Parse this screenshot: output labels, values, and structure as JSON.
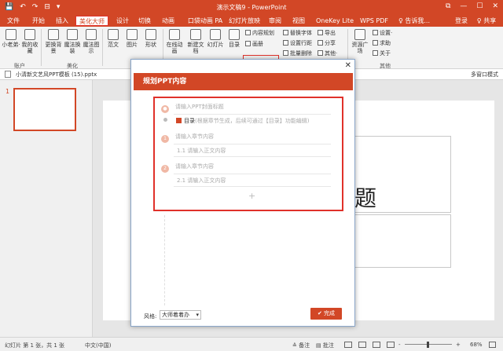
{
  "app": {
    "title": "演示文稿9 - PowerPoint"
  },
  "quick_access": {
    "save": "💾",
    "undo": "↶",
    "redo": "↷",
    "present": "⊟",
    "more": "▾"
  },
  "window_controls": {
    "restore": "⧉",
    "minimize": "—",
    "maximize": "☐",
    "close": "✕"
  },
  "tabs": [
    "文件",
    "开始",
    "插入",
    "美化大师",
    "设计",
    "切换",
    "动画",
    "口袋动画 PA",
    "幻灯片放映",
    "审阅",
    "视图",
    "OneKey Lite",
    "WPS PDF"
  ],
  "active_tab": "美化大师",
  "tell_me": "♀ 告诉我...",
  "login": "登录",
  "share": "♀ 共享",
  "ribbon": {
    "btn_xiaolaodi": "小老弟·",
    "btn_favorites": "我的收藏",
    "btn_replace_bg": "更换背景",
    "btn_magic_replace": "魔法换装",
    "btn_magic_illustrate": "魔法图示",
    "btn_template": "范文",
    "btn_image": "图片",
    "btn_shape": "形状",
    "btn_online_anim": "在线动画",
    "btn_new_doc": "新建文档",
    "btn_slides": "幻灯片",
    "btn_toc": "目录",
    "content_plan": "内容规划",
    "album": "画册",
    "replace_font": "替换字体",
    "set_line_spacing": "设置行距",
    "batch_delete": "批量删除",
    "export": "导出",
    "share_item": "分享",
    "other": "其他·",
    "resources": "资源广场",
    "settings": "设置·",
    "help": "求助",
    "about": "关于",
    "group_account": "账户",
    "group_beautify": "美化",
    "group_other": "其他"
  },
  "document_tab": {
    "name": "小清新文艺风PPT模板 (15).pptx",
    "multi_window": "多窗口模式"
  },
  "slides_panel": {
    "number": "1"
  },
  "slide": {
    "title_fragment": "标题"
  },
  "dialog": {
    "title": "规划PPT内容",
    "close": "✕",
    "cover_placeholder": "请输入PPT封面标题",
    "toc_label": "目录",
    "toc_hint": "(根据章节生成，后续可通过【目录】功能编辑)",
    "chapters": [
      {
        "num": "1",
        "title": "请输入章节内容",
        "sub": "1.1  请输入正文内容"
      },
      {
        "num": "2",
        "title": "请输入章节内容",
        "sub": "2.1  请输入正文内容"
      }
    ],
    "add": "+",
    "style_label": "风格:",
    "style_value": "大师着着办",
    "style_arrow": "▾",
    "finish": "完成",
    "finish_icon": "✔"
  },
  "status": {
    "slide_info": "幻灯片 第 1 张，共 1 张",
    "language": "中文(中国)",
    "notes": "≙ 备注",
    "comments": "▤ 批注",
    "zoom": "68%",
    "zoom_minus": "-",
    "zoom_plus": "+"
  }
}
